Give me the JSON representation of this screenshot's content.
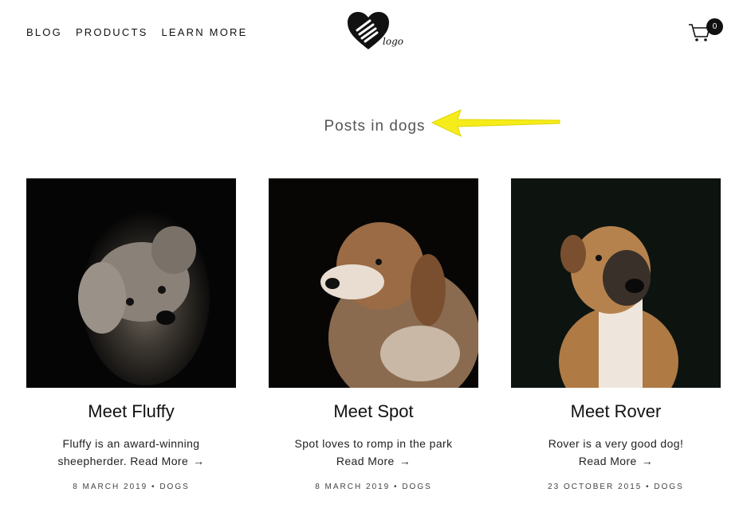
{
  "nav": {
    "items": [
      "BLOG",
      "PRODUCTS",
      "LEARN MORE"
    ]
  },
  "logo": {
    "text": "logo"
  },
  "cart": {
    "count": "0"
  },
  "page": {
    "heading": "Posts in dogs"
  },
  "colors": {
    "annotation_arrow": "#f5ec1a",
    "text": "#111111",
    "background": "#ffffff"
  },
  "posts": [
    {
      "title": "Meet Fluffy",
      "excerpt": "Fluffy is an award-winning sheepherder.",
      "read_more": "Read More",
      "arrow": "→",
      "date": "8 MARCH 2019",
      "separator": "•",
      "category": "DOGS"
    },
    {
      "title": "Meet Spot",
      "excerpt": "Spot loves to romp in the park",
      "read_more": "Read More",
      "arrow": "→",
      "date": "8 MARCH 2019",
      "separator": "•",
      "category": "DOGS"
    },
    {
      "title": "Meet Rover",
      "excerpt": "Rover is a very good dog!",
      "read_more": "Read More",
      "arrow": "→",
      "date": "23 OCTOBER 2015",
      "separator": "•",
      "category": "DOGS"
    }
  ]
}
